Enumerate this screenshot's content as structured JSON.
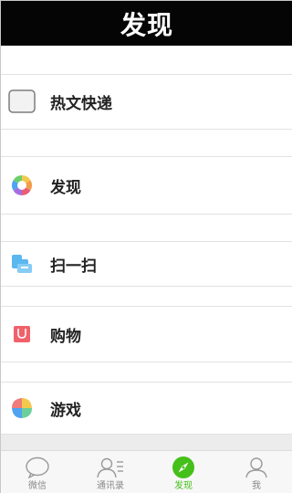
{
  "header": {
    "title": "发现"
  },
  "menu": {
    "items": [
      {
        "label": "热文快递",
        "icon": "news-box-icon"
      },
      {
        "label": "发现",
        "icon": "discover-pinwheel-icon"
      },
      {
        "label": "扫一扫",
        "icon": "scan-icon"
      },
      {
        "label": "购物",
        "icon": "shopping-bag-icon"
      },
      {
        "label": "游戏",
        "icon": "game-pinwheel-icon"
      }
    ]
  },
  "tabbar": {
    "tabs": [
      {
        "label": "微信",
        "icon": "chat-bubble-icon",
        "active": false
      },
      {
        "label": "通讯录",
        "icon": "contacts-icon",
        "active": false
      },
      {
        "label": "发现",
        "icon": "compass-icon",
        "active": true
      },
      {
        "label": "我",
        "icon": "person-icon",
        "active": false
      }
    ]
  },
  "colors": {
    "header_bg": "#050505",
    "accent_green": "#45c01a",
    "inactive_gray": "#8a8a8a",
    "shopping_red": "#f0616a",
    "scan_blue": "#5bb7f0"
  }
}
